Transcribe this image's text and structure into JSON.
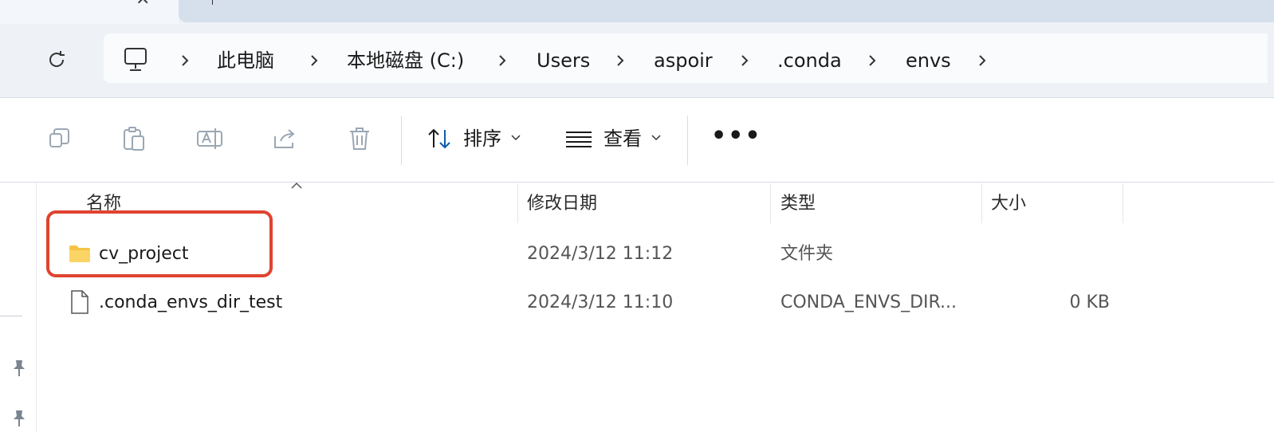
{
  "breadcrumb": {
    "items": [
      "此电脑",
      "本地磁盘 (C:)",
      "Users",
      "aspoir",
      ".conda",
      "envs"
    ]
  },
  "toolbar": {
    "sort_label": "排序",
    "view_label": "查看"
  },
  "columns": {
    "name": "名称",
    "modified": "修改日期",
    "type": "类型",
    "size": "大小"
  },
  "files": [
    {
      "name": "cv_project",
      "modified": "2024/3/12 11:12",
      "type": "文件夹",
      "size": "",
      "icon": "folder-icon"
    },
    {
      "name": ".conda_envs_dir_test",
      "modified": "2024/3/12 11:10",
      "type": "CONDA_ENVS_DIR...",
      "size": "0 KB",
      "icon": "file-icon"
    }
  ],
  "colors": {
    "accent": "#0a5cad",
    "highlight_border": "#e0432f",
    "folder": "#f5c445"
  }
}
